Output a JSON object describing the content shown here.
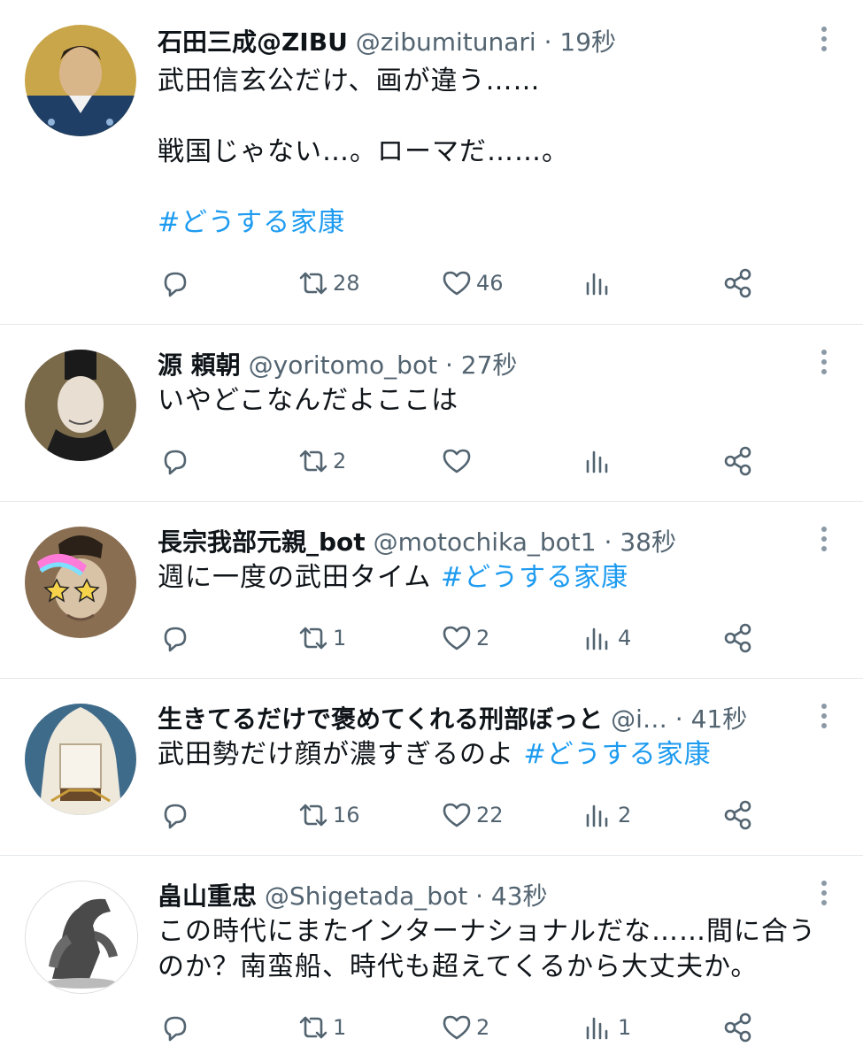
{
  "icons": {
    "reply": "reply-icon",
    "retweet": "retweet-icon",
    "like": "heart-icon",
    "views": "views-icon",
    "share": "share-icon",
    "more": "more-icon"
  },
  "colors": {
    "link": "#1d9bf0",
    "secondary": "#536471",
    "divider": "#e4e8eb"
  },
  "tweets": [
    {
      "display_name": "石田三成@ZIBU",
      "handle": "@zibumitunari",
      "sep": "·",
      "time": "19秒",
      "text_before": "武田信玄公だけ、画が違う……\n\n戦国じゃない…。ローマだ……。\n\n",
      "hashtag": "#どうする家康",
      "text_after": "",
      "retweets": "28",
      "likes": "46",
      "views": ""
    },
    {
      "display_name": "源 頼朝",
      "handle": "@yoritomo_bot",
      "sep": "·",
      "time": "27秒",
      "text_before": "いやどこなんだよここは",
      "hashtag": "",
      "text_after": "",
      "retweets": "2",
      "likes": "",
      "views": ""
    },
    {
      "display_name": "長宗我部元親_bot",
      "handle": "@motochika_bot1",
      "sep": "·",
      "time": "38秒",
      "text_before": "週に一度の武田タイム ",
      "hashtag": "#どうする家康",
      "text_after": "",
      "retweets": "1",
      "likes": "2",
      "views": "4"
    },
    {
      "display_name": "生きてるだけで褒めてくれる刑部ぼっと",
      "handle": "@i…",
      "sep": "·",
      "time": "41秒",
      "text_before": "武田勢だけ顔が濃すぎるのよ ",
      "hashtag": "#どうする家康",
      "text_after": "",
      "retweets": "16",
      "likes": "22",
      "views": "2"
    },
    {
      "display_name": "畠山重忠",
      "handle": "@Shigetada_bot",
      "sep": "·",
      "time": "43秒",
      "text_before": "この時代にまたインターナショナルだな……間に合うのか？南蛮船、時代も超えてくるから大丈夫か。",
      "hashtag": "",
      "text_after": "",
      "retweets": "1",
      "likes": "2",
      "views": "1"
    }
  ]
}
